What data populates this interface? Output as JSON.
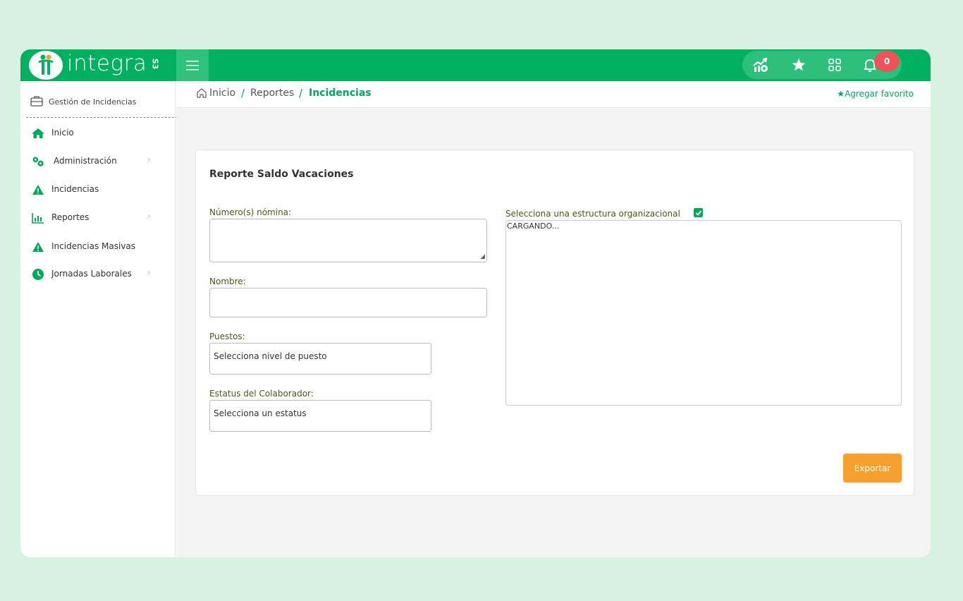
{
  "brand": {
    "name": "integra",
    "suffix": "S3"
  },
  "topbar": {
    "notifications_count": "0"
  },
  "sidebar": {
    "header_label": "Gestión de Incidencias",
    "items": [
      {
        "label": "Inicio",
        "icon": "home-icon",
        "has_submenu": false
      },
      {
        "label": "Administración",
        "icon": "gears-icon",
        "has_submenu": true
      },
      {
        "label": "Incidencias",
        "icon": "warning-icon",
        "has_submenu": false
      },
      {
        "label": "Reportes",
        "icon": "bar-chart-icon",
        "has_submenu": true
      },
      {
        "label": "Incidencias Masivas",
        "icon": "warning-icon",
        "has_submenu": false
      },
      {
        "label": "Jornadas Laborales",
        "icon": "clock-icon",
        "has_submenu": true
      }
    ]
  },
  "breadcrumb": {
    "items": [
      "Inicio",
      "Reportes",
      "Incidencias"
    ],
    "separator": "/"
  },
  "favorite": {
    "label": "Agregar favorito"
  },
  "form": {
    "title": "Reporte Saldo Vacaciones",
    "nomina_label": "Número(s) nómina:",
    "nombre_label": "Nombre:",
    "puestos_label": "Puestos:",
    "puestos_value": "Selecciona nivel de puesto",
    "estatus_label": "Estatus del Colaborador:",
    "estatus_value": "Selecciona un estatus",
    "org_label": "Selecciona una estructura organizacional",
    "org_checked": true,
    "org_loading": "CARGANDO...",
    "export_label": "Exportar"
  },
  "colors": {
    "brand_green": "#00b060",
    "accent_orange": "#f7a02c",
    "badge_red": "#f0525a"
  }
}
